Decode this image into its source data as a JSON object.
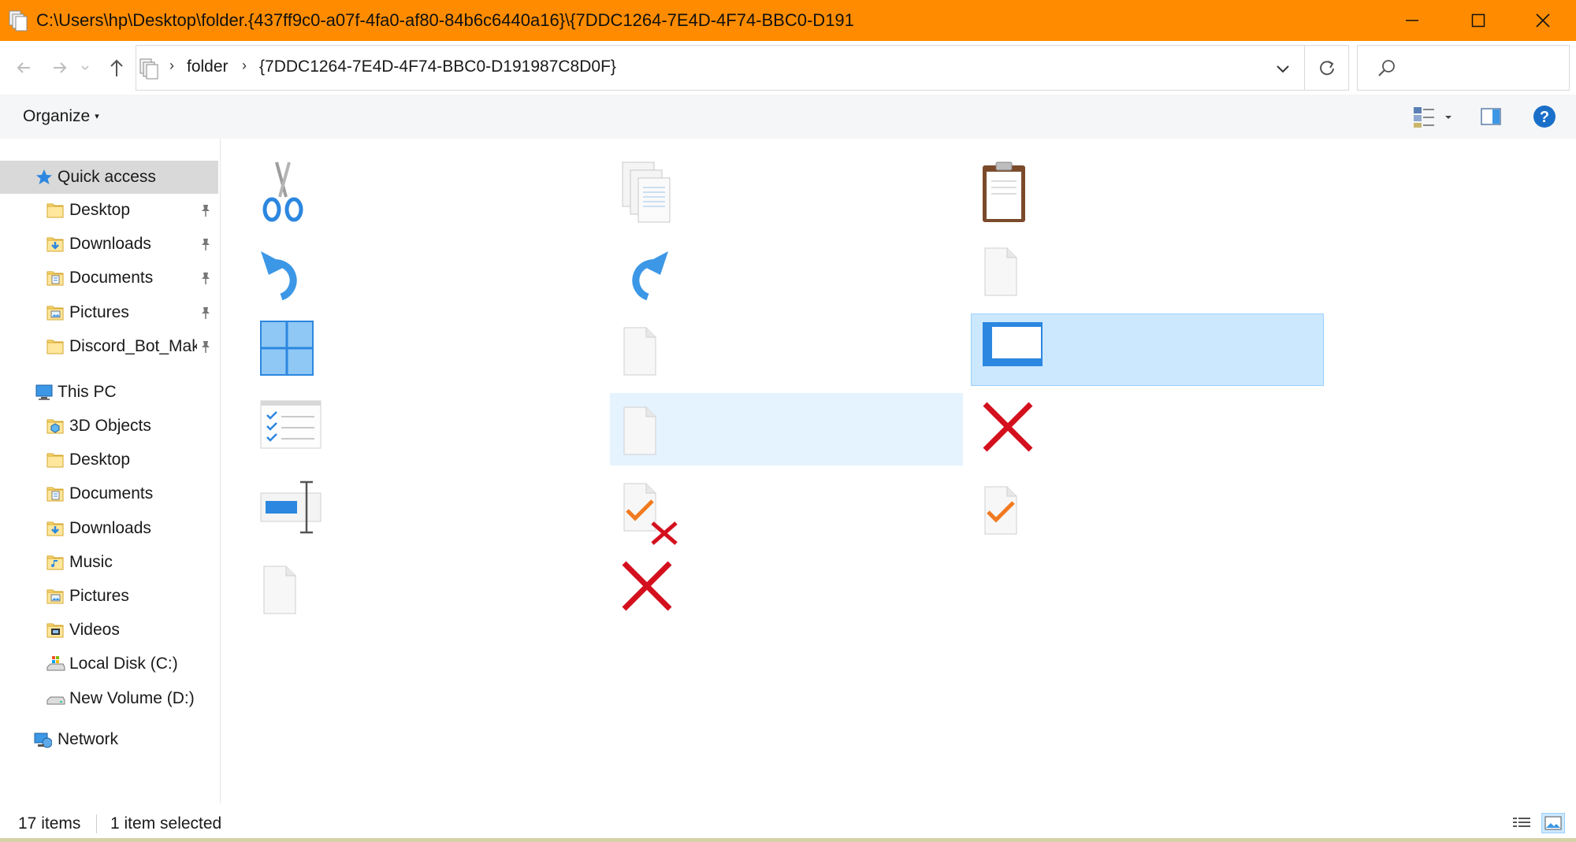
{
  "window": {
    "title": "C:\\Users\\hp\\Desktop\\folder.{437ff9c0-a07f-4fa0-af80-84b6c6440a16}\\{7DDC1264-7E4D-4F74-BBC0-D191"
  },
  "address": {
    "crumbs": [
      "folder",
      "{7DDC1264-7E4D-4F74-BBC0-D191987C8D0F}"
    ]
  },
  "toolbar": {
    "organize_label": "Organize"
  },
  "nav": {
    "quick_access": "Quick access",
    "pinned": [
      "Desktop",
      "Downloads",
      "Documents",
      "Pictures",
      "Discord_Bot_Mak"
    ],
    "this_pc": "This PC",
    "pc_items": [
      "3D Objects",
      "Desktop",
      "Documents",
      "Downloads",
      "Music",
      "Pictures",
      "Videos",
      "Local Disk (C:)",
      "New Volume (D:)"
    ],
    "network": "Network"
  },
  "content": {
    "items": [
      {
        "icon": "scissors-icon"
      },
      {
        "icon": "copy-icon"
      },
      {
        "icon": "clipboard-icon"
      },
      {
        "icon": "undo-icon"
      },
      {
        "icon": "redo-icon"
      },
      {
        "icon": "blank-file-icon"
      },
      {
        "icon": "tiles-icon"
      },
      {
        "icon": "blank-file-icon"
      },
      {
        "icon": "window-icon",
        "selected": true
      },
      {
        "icon": "checklist-icon"
      },
      {
        "icon": "blank-file-icon",
        "hover": true
      },
      {
        "icon": "red-x-icon"
      },
      {
        "icon": "rename-icon"
      },
      {
        "icon": "check-x-file-icon"
      },
      {
        "icon": "check-file-icon"
      },
      {
        "icon": "blank-file-icon"
      },
      {
        "icon": "red-x-icon"
      }
    ]
  },
  "status": {
    "count": "17 items",
    "selection": "1 item selected"
  },
  "colors": {
    "titlebar": "#ff8c00",
    "selection": "#cce8ff",
    "hover": "#e5f3ff",
    "accent_blue": "#3c97e6",
    "red_x": "#d4101e"
  }
}
